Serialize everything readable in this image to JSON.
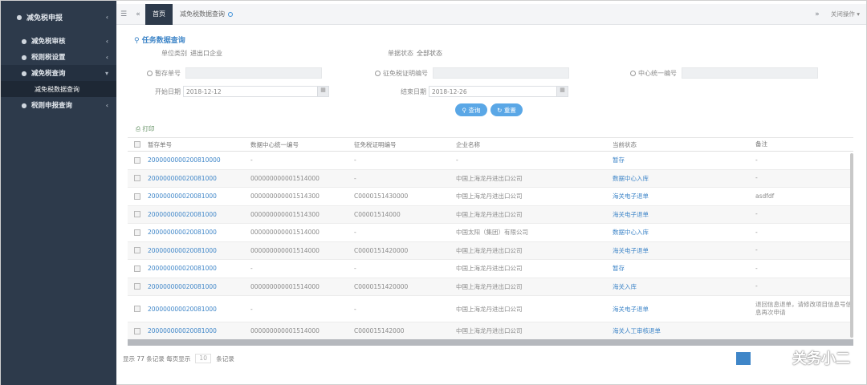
{
  "sidebar": {
    "title": "减免税申报",
    "items": [
      {
        "label": "减免税审核"
      },
      {
        "label": "税则税设置"
      },
      {
        "label": "减免税查询"
      },
      {
        "label": "减免税数据查询"
      },
      {
        "label": "税则申报查询"
      }
    ]
  },
  "topbar": {
    "home_tab": "首页",
    "active_tab": "减免税数据查询",
    "right_action": "关闭操作"
  },
  "query": {
    "title": "任务数据查询",
    "row1": {
      "label1": "单位类别",
      "value1": "进出口企业",
      "label2": "单据状态",
      "value2": "全部状态"
    },
    "radios": {
      "r1": "暂存单号",
      "r2": "征免税证明编号",
      "r3": "中心统一编号"
    },
    "dates": {
      "start_label": "开始日期",
      "start_value": "2018-12-12",
      "end_label": "结束日期",
      "end_value": "2018-12-26"
    },
    "search_button": "查询",
    "reset_button": "重置"
  },
  "print_label": "打印",
  "table": {
    "headers": [
      "暂存单号",
      "数据中心统一编号",
      "征免税证明编号",
      "企业名称",
      "当前状态",
      "备注"
    ],
    "rows": [
      {
        "temp_no": "2000000000200810000",
        "center_no": "-",
        "cert_no": "-",
        "company": "-",
        "status": "暂存",
        "note": "-"
      },
      {
        "temp_no": "200000000020081000",
        "center_no": "000000000001514000",
        "cert_no": "-",
        "company": "中国上海龙丹进出口公司",
        "status": "数据中心入库",
        "note": "-"
      },
      {
        "temp_no": "200000000020081000",
        "center_no": "000000000001514300",
        "cert_no": "C0000151430000",
        "company": "中国上海龙丹进出口公司",
        "status": "海关电子退单",
        "note": "asdfdf"
      },
      {
        "temp_no": "200000000020081000",
        "center_no": "000000000001514300",
        "cert_no": "C00001514000",
        "company": "中国上海龙丹进出口公司",
        "status": "海关电子退单",
        "note": "-"
      },
      {
        "temp_no": "200000000020081000",
        "center_no": "000000000001514000",
        "cert_no": "-",
        "company": "中国太阳（集团）有限公司",
        "status": "数据中心入库",
        "note": "-"
      },
      {
        "temp_no": "200000000020081000",
        "center_no": "000000000001514000",
        "cert_no": "C0000151420000",
        "company": "中国上海龙丹进出口公司",
        "status": "海关电子退单",
        "note": "-"
      },
      {
        "temp_no": "200000000020081000",
        "center_no": "-",
        "cert_no": "-",
        "company": "中国上海龙丹进出口公司",
        "status": "暂存",
        "note": "-"
      },
      {
        "temp_no": "200000000020081000",
        "center_no": "000000000001514000",
        "cert_no": "C0000151420000",
        "company": "中国上海龙丹进出口公司",
        "status": "海关入库",
        "note": "-"
      },
      {
        "temp_no": "200000000020081000",
        "center_no": "-",
        "cert_no": "-",
        "company": "中国上海龙丹进出口公司",
        "status": "海关电子退单",
        "note": "退回信息退单，请修改项目信息号信息再次申请"
      },
      {
        "temp_no": "200000000020081000",
        "center_no": "000000000001514000",
        "cert_no": "C000015142000",
        "company": "中国上海龙丹进出口公司",
        "status": "海关人工审核退单",
        "note": ""
      }
    ]
  },
  "pager": {
    "summary": "显示 77 条记录 每页显示",
    "size": "10",
    "suffix": "条记录"
  },
  "watermark": "关务小二",
  "colors": {
    "sidebar": "#2d3a4b",
    "accent": "#3f86c8",
    "button": "#5aa7e6"
  }
}
